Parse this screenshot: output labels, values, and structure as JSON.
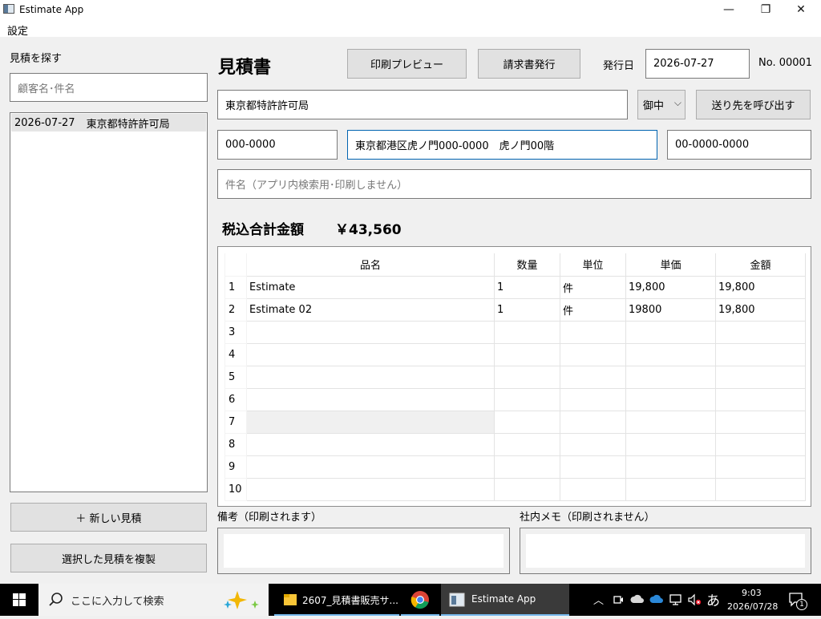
{
  "window": {
    "title": "Estimate App",
    "minimize": "—",
    "maximize": "❐",
    "close": "✕"
  },
  "menu": {
    "settings": "設定"
  },
  "sidebar": {
    "search_label": "見積を探す",
    "search_placeholder": "顧客名･件名",
    "items": [
      {
        "date": "2026-07-27",
        "name": "東京都特許許可局"
      }
    ],
    "new_button": "＋ 新しい見積",
    "duplicate_button": "選択した見積を複製"
  },
  "header": {
    "title": "見積書",
    "print_preview": "印刷プレビュー",
    "issue_invoice": "請求書発行",
    "issue_date_label": "発行日",
    "issue_date": "2026-07-27",
    "doc_number": "No. 00001"
  },
  "customer": {
    "name": "東京都特許許可局",
    "honorific": "御中",
    "recall_button": "送り先を呼び出す",
    "postal_code": "000-0000",
    "address": "東京都港区虎ノ門000-0000　虎ノ門00階",
    "phone": "00-0000-0000",
    "subject_placeholder": "件名（アプリ内検索用･印刷しません）"
  },
  "total": {
    "label": "税込合計金額",
    "value": "￥43,560"
  },
  "grid": {
    "columns": [
      "品名",
      "数量",
      "単位",
      "単価",
      "金額"
    ],
    "rows": [
      {
        "no": "1",
        "item": "Estimate",
        "qty": "1",
        "unit": "件",
        "price": "19,800",
        "amount": "19,800"
      },
      {
        "no": "2",
        "item": "Estimate 02",
        "qty": "1",
        "unit": "件",
        "price": "19800",
        "amount": "19,800"
      },
      {
        "no": "3",
        "item": "",
        "qty": "",
        "unit": "",
        "price": "",
        "amount": ""
      },
      {
        "no": "4",
        "item": "",
        "qty": "",
        "unit": "",
        "price": "",
        "amount": ""
      },
      {
        "no": "5",
        "item": "",
        "qty": "",
        "unit": "",
        "price": "",
        "amount": ""
      },
      {
        "no": "6",
        "item": "",
        "qty": "",
        "unit": "",
        "price": "",
        "amount": ""
      },
      {
        "no": "7",
        "item": "",
        "qty": "",
        "unit": "",
        "price": "",
        "amount": ""
      },
      {
        "no": "8",
        "item": "",
        "qty": "",
        "unit": "",
        "price": "",
        "amount": ""
      },
      {
        "no": "9",
        "item": "",
        "qty": "",
        "unit": "",
        "price": "",
        "amount": ""
      },
      {
        "no": "10",
        "item": "",
        "qty": "",
        "unit": "",
        "price": "",
        "amount": ""
      }
    ]
  },
  "remarks": {
    "printed_label": "備考（印刷されます）",
    "internal_label": "社内メモ（印刷されません）"
  },
  "taskbar": {
    "search_placeholder": "ここに入力して検索",
    "file_explorer": "2607_見積書販売サ...",
    "app": "Estimate App",
    "ime": "あ",
    "time": "9:03",
    "date": "2026/07/28",
    "notification_count": "1"
  },
  "colors": {
    "accent": "#0063b1",
    "taskbar": "#000000",
    "selected_row": "#e5e5e5"
  }
}
